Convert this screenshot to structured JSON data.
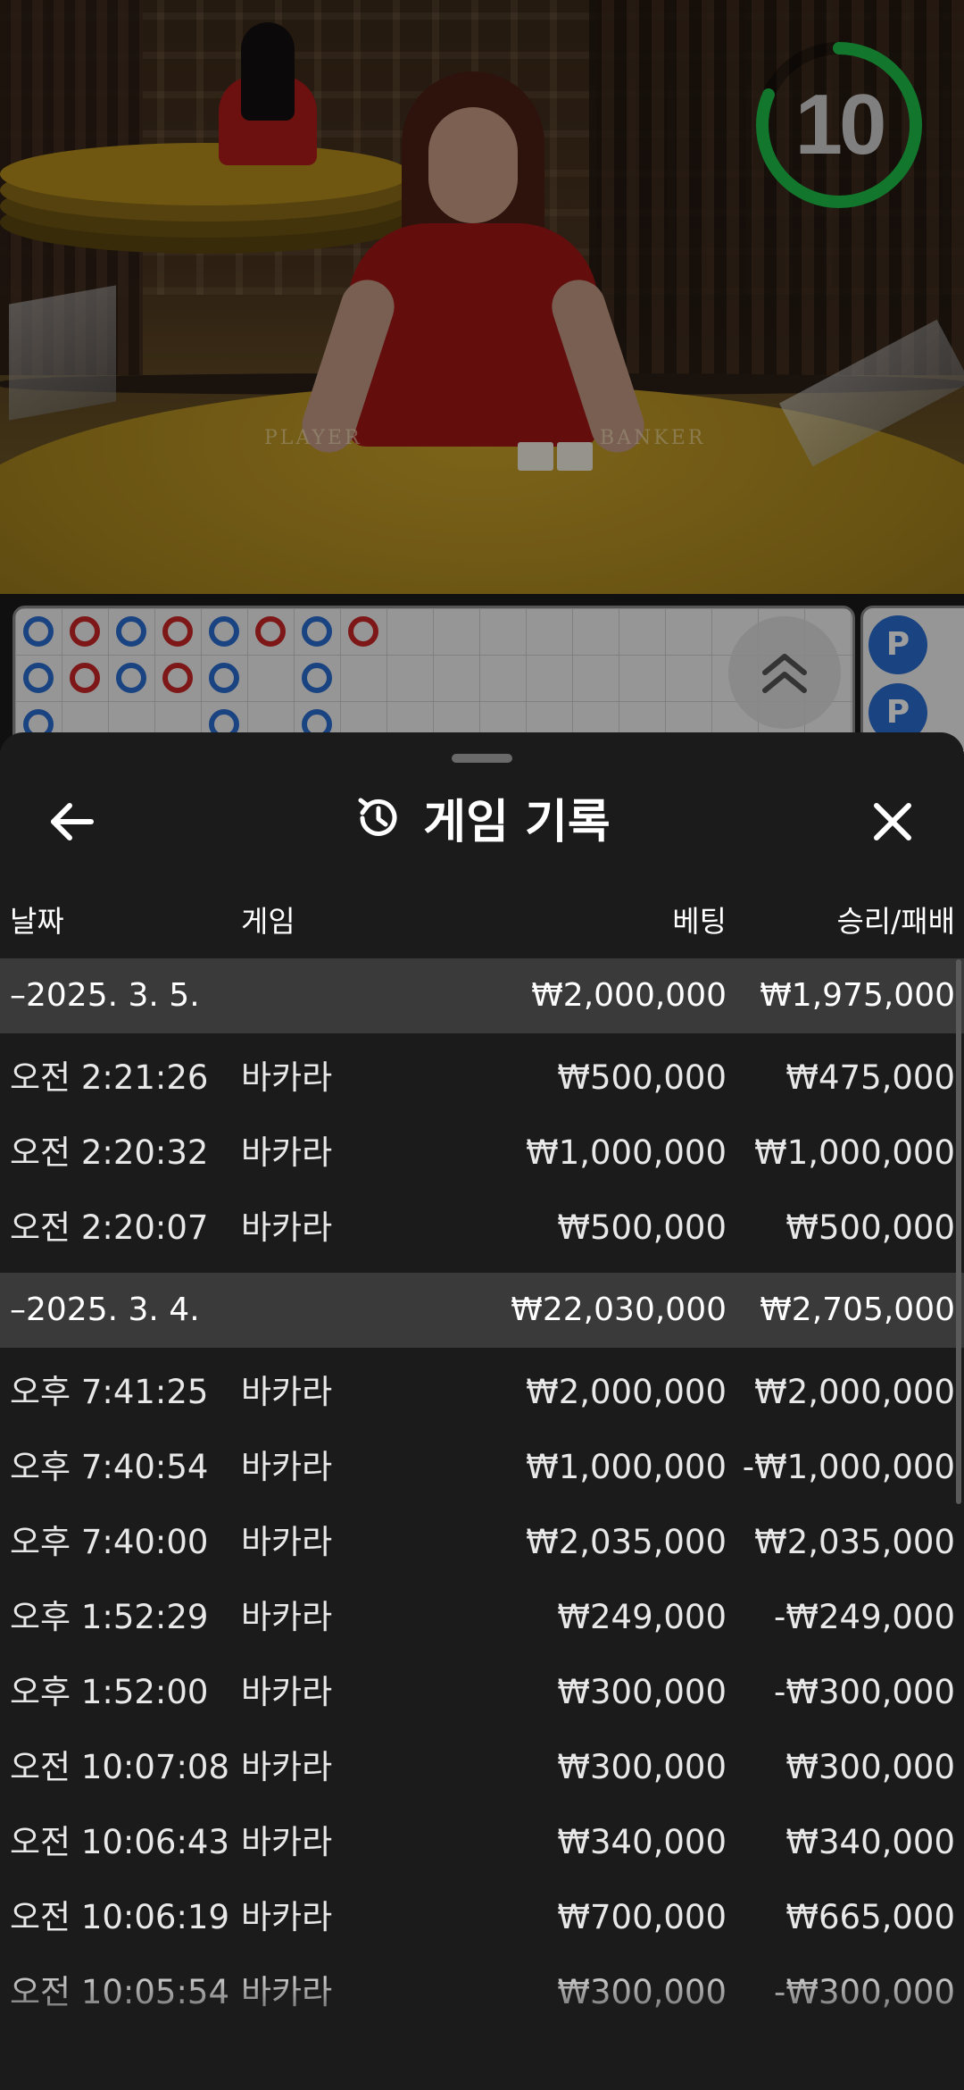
{
  "stream": {
    "countdown": "10",
    "table_labels": [
      "PLAYER",
      "BANKER"
    ],
    "timer_color": "#1fbf4a"
  },
  "roadmap": {
    "big_road_beads": [
      [
        "b",
        "r",
        "b",
        "r",
        "b",
        "r",
        "b",
        "r"
      ],
      [
        "b",
        "r",
        "b",
        "r",
        "b",
        "",
        "b",
        ""
      ],
      [
        "b",
        "",
        "",
        "",
        "b",
        "",
        "b",
        ""
      ]
    ],
    "side_pills": [
      "P",
      "P"
    ]
  },
  "history": {
    "title": "게임 기록",
    "columns": {
      "date": "날짜",
      "game": "게임",
      "bet": "베팅",
      "win_loss": "승리/패배"
    },
    "groups": [
      {
        "date": "–2025. 3. 5.",
        "total_bet": "₩2,000,000",
        "total_win": "₩1,975,000",
        "rows": [
          {
            "time": "오전 2:21:26",
            "game": "바카라",
            "bet": "₩500,000",
            "win": "₩475,000"
          },
          {
            "time": "오전 2:20:32",
            "game": "바카라",
            "bet": "₩1,000,000",
            "win": "₩1,000,000"
          },
          {
            "time": "오전 2:20:07",
            "game": "바카라",
            "bet": "₩500,000",
            "win": "₩500,000"
          }
        ]
      },
      {
        "date": "–2025. 3. 4.",
        "total_bet": "₩22,030,000",
        "total_win": "₩2,705,000",
        "rows": [
          {
            "time": "오후 7:41:25",
            "game": "바카라",
            "bet": "₩2,000,000",
            "win": "₩2,000,000"
          },
          {
            "time": "오후 7:40:54",
            "game": "바카라",
            "bet": "₩1,000,000",
            "win": "-₩1,000,000"
          },
          {
            "time": "오후 7:40:00",
            "game": "바카라",
            "bet": "₩2,035,000",
            "win": "₩2,035,000"
          },
          {
            "time": "오후 1:52:29",
            "game": "바카라",
            "bet": "₩249,000",
            "win": "-₩249,000"
          },
          {
            "time": "오후 1:52:00",
            "game": "바카라",
            "bet": "₩300,000",
            "win": "-₩300,000"
          },
          {
            "time": "오전 10:07:08",
            "game": "바카라",
            "bet": "₩300,000",
            "win": "₩300,000"
          },
          {
            "time": "오전 10:06:43",
            "game": "바카라",
            "bet": "₩340,000",
            "win": "₩340,000"
          },
          {
            "time": "오전 10:06:19",
            "game": "바카라",
            "bet": "₩700,000",
            "win": "₩665,000"
          },
          {
            "time": "오전 10:05:54",
            "game": "바카라",
            "bet": "₩300,000",
            "win": "-₩300,000"
          }
        ]
      }
    ]
  },
  "icons": {
    "back": "arrow-left-icon",
    "history": "history-clock-icon",
    "close": "close-x-icon",
    "expand": "chevron-double-up-icon"
  }
}
